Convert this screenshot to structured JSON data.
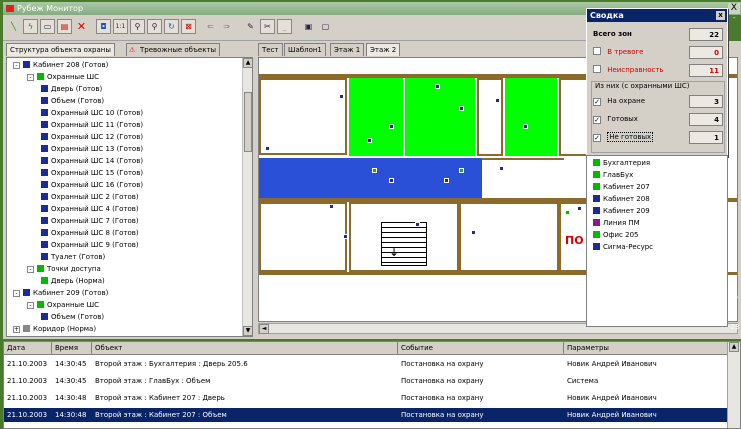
{
  "window": {
    "title": "Рубеж Монитор",
    "close_label": "X",
    "edge_marks": [
      "-",
      "-6",
      "-23"
    ]
  },
  "toolbar": {
    "icons": [
      "line-tool-icon",
      "lightning-icon",
      "document-icon",
      "delete-icon",
      "cross-icon",
      "select-icon",
      "zoom-1-1-icon",
      "zoom-in-icon",
      "zoom-out-icon",
      "refresh-icon",
      "exit-icon",
      "arrow-left-icon",
      "arrow-right-icon",
      "edit-icon",
      "cut-icon",
      "empty-icon",
      "save-icon",
      "window-icon"
    ],
    "zoom_label": "1:1"
  },
  "left_tabs": {
    "structure": "Структура объекта охраны",
    "alarms": "Тревожные объекты"
  },
  "tree": [
    {
      "level": 1,
      "label": "Кабинет 208  (Готов)",
      "color": "#1a2c9c",
      "expander": "-"
    },
    {
      "level": 2,
      "label": "Охранные ШС",
      "color": "#0b0",
      "expander": "-"
    },
    {
      "level": 3,
      "label": "Дверь  (Готов)",
      "color": "#1a2c9c"
    },
    {
      "level": 3,
      "label": "Объем  (Готов)",
      "color": "#1a2c9c"
    },
    {
      "level": 3,
      "label": "Охранный ШС 10  (Готов)",
      "color": "#1a2c9c"
    },
    {
      "level": 3,
      "label": "Охранный ШС 11  (Готов)",
      "color": "#1a2c9c"
    },
    {
      "level": 3,
      "label": "Охранный ШС 12  (Готов)",
      "color": "#1a2c9c"
    },
    {
      "level": 3,
      "label": "Охранный ШС 13  (Готов)",
      "color": "#1a2c9c"
    },
    {
      "level": 3,
      "label": "Охранный ШС 14  (Готов)",
      "color": "#1a2c9c"
    },
    {
      "level": 3,
      "label": "Охранный ШС 15  (Готов)",
      "color": "#1a2c9c"
    },
    {
      "level": 3,
      "label": "Охранный ШС 16  (Готов)",
      "color": "#1a2c9c"
    },
    {
      "level": 3,
      "label": "Охранный ШС 2  (Готов)",
      "color": "#1a2c9c"
    },
    {
      "level": 3,
      "label": "Охранный ШС 4  (Готов)",
      "color": "#1a2c9c"
    },
    {
      "level": 3,
      "label": "Охранный ШС 7  (Готов)",
      "color": "#1a2c9c"
    },
    {
      "level": 3,
      "label": "Охранный ШС 8  (Готов)",
      "color": "#1a2c9c"
    },
    {
      "level": 3,
      "label": "Охранный ШС 9  (Готов)",
      "color": "#1a2c9c"
    },
    {
      "level": 3,
      "label": "Туалет  (Готов)",
      "color": "#1a2c9c"
    },
    {
      "level": 2,
      "label": "Точки доступа",
      "color": "#0b0",
      "expander": "-"
    },
    {
      "level": 3,
      "label": "Дверь  (Норма)",
      "color": "#0b0"
    },
    {
      "level": 1,
      "label": "Кабинет 209  (Готов)",
      "color": "#1a2c9c",
      "expander": "-"
    },
    {
      "level": 2,
      "label": "Охранные ШС",
      "color": "#0b0",
      "expander": "-"
    },
    {
      "level": 3,
      "label": "Объем  (Готов)",
      "color": "#1a2c9c"
    },
    {
      "level": 1,
      "label": "Коридор  (Норма)",
      "color": "#888888",
      "expander": "+"
    }
  ],
  "map_tabs": [
    "Тест",
    "Шаблон1",
    "Этаж 1",
    "Этаж 2"
  ],
  "map": {
    "door_sign": "ПО"
  },
  "summary": {
    "title": "Сводка",
    "close_label": "x",
    "total_label": "Всего зон",
    "total": "22",
    "alarm_label": "В тревоге",
    "alarm": "0",
    "fault_label": "Неисправность",
    "fault": "11",
    "group_label": "Из них (с охранными ШС)",
    "armed_label": "На охране",
    "armed": "3",
    "ready_label": "Готовых",
    "ready": "4",
    "notready_label": "Не готовых",
    "notready": "1",
    "check_mark": "✓"
  },
  "legend": [
    {
      "label": "Бухгалтерия",
      "color": "#0b0"
    },
    {
      "label": "ГлавБух",
      "color": "#0b0"
    },
    {
      "label": "Кабинет 207",
      "color": "#0b0"
    },
    {
      "label": "Кабинет 208",
      "color": "#1a2c9c"
    },
    {
      "label": "Кабинет 209",
      "color": "#1a2c9c"
    },
    {
      "label": "Линия ПМ",
      "color": "#8a1a8a"
    },
    {
      "label": "Офис 205",
      "color": "#0b0"
    },
    {
      "label": "Сигма-Ресурс",
      "color": "#1a2c9c"
    }
  ],
  "log": {
    "columns": [
      "Дата",
      "Время",
      "Объект",
      "Событие",
      "Параметры"
    ],
    "rows": [
      {
        "date": "21.10.2003",
        "time": "14:30:45",
        "object": "Второй этаж : Бухгалтерия : Дверь 205.6",
        "event": "Постановка на охрану",
        "params": "Новик Андрей Иванович"
      },
      {
        "date": "21.10.2003",
        "time": "14:30:45",
        "object": "Второй этаж : ГлавБух : Объем",
        "event": "Постановка на охрану",
        "params": "Система"
      },
      {
        "date": "21.10.2003",
        "time": "14:30:48",
        "object": "Второй этаж : Кабинет 207 : Дверь",
        "event": "Постановка на охрану",
        "params": "Новик Андрей Иванович"
      },
      {
        "date": "21.10.2003",
        "time": "14:30:48",
        "object": "Второй этаж : Кабинет 207 : Объем",
        "event": "Постановка на охрану",
        "params": "Новик Андрей Иванович"
      }
    ]
  }
}
